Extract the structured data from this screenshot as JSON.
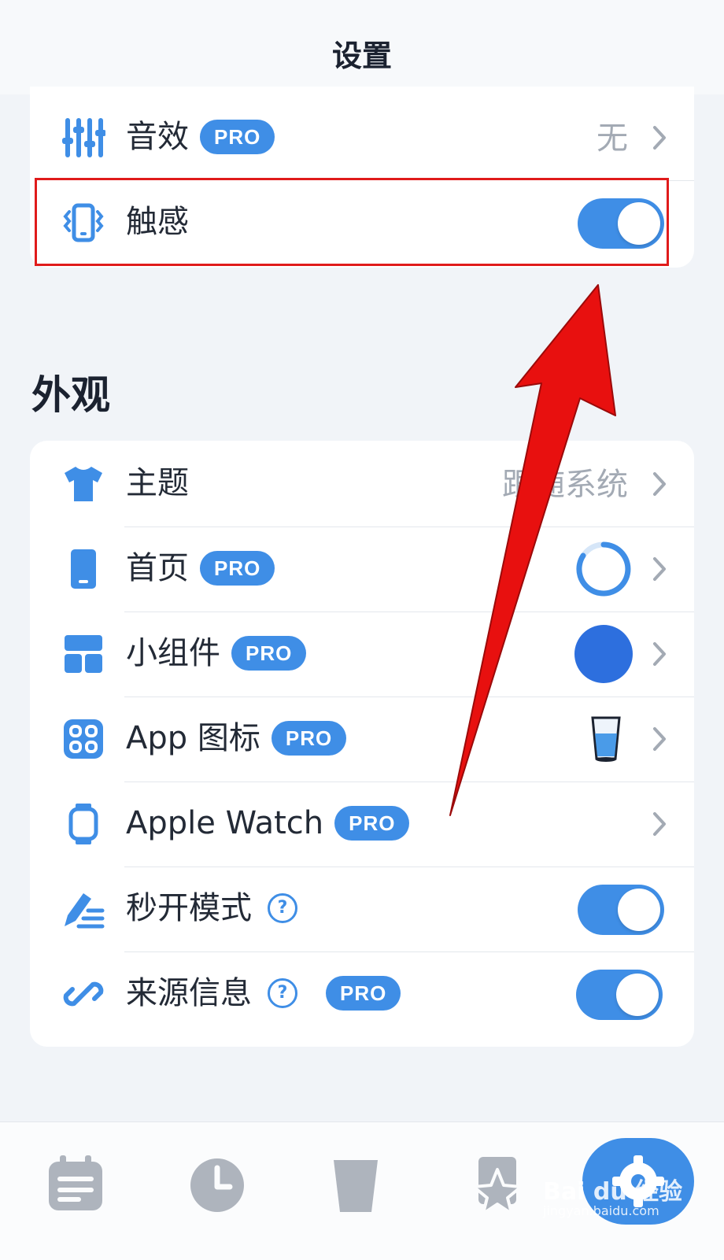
{
  "header": {
    "title": "设置"
  },
  "sound": {
    "label": "音效",
    "badge": "PRO",
    "value": "无",
    "icon": "sliders-icon"
  },
  "haptics": {
    "label": "触感",
    "icon": "vibrating-phone-icon",
    "enabled": true
  },
  "appearance": {
    "title": "外观",
    "rows": [
      {
        "label": "主题",
        "value": "跟随系统",
        "icon": "tshirt-icon"
      },
      {
        "label": "首页",
        "badge": "PRO",
        "icon": "phone-icon"
      },
      {
        "label": "小组件",
        "badge": "PRO",
        "icon": "widgets-icon"
      },
      {
        "label": "App 图标",
        "badge": "PRO",
        "icon": "app-grid-icon"
      },
      {
        "label": "Apple Watch",
        "badge": "PRO",
        "icon": "watch-icon"
      },
      {
        "label": "秒开模式",
        "help": "?",
        "icon": "pen-list-icon",
        "enabled": true
      },
      {
        "label": "来源信息",
        "help": "?",
        "badge": "PRO",
        "icon": "link-icon",
        "enabled": true
      }
    ]
  },
  "tabbar": {
    "tabs": [
      {
        "icon": "calendar-list-icon"
      },
      {
        "icon": "clock-icon"
      },
      {
        "icon": "cup-icon"
      },
      {
        "icon": "star-badge-icon"
      },
      {
        "icon": "gear-icon",
        "active": true
      }
    ]
  },
  "watermark": {
    "brand": "Bai du 经验",
    "url": "jingyan.baidu.com"
  },
  "colors": {
    "accent": "#3f8ee6",
    "background": "#f1f4f8",
    "annotation": "#e01b1b"
  }
}
